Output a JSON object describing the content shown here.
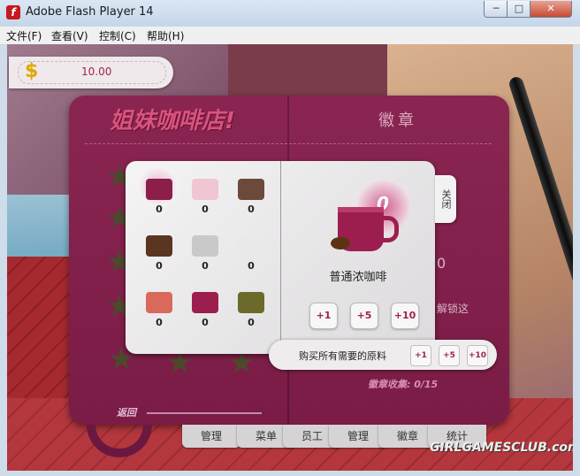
{
  "window": {
    "title": "Adobe Flash Player 14",
    "min": "─",
    "max": "□",
    "close": "✕",
    "app_icon_glyph": "f"
  },
  "menu": {
    "items": [
      "文件(F)",
      "查看(V)",
      "控制(C)",
      "帮助(H)"
    ]
  },
  "hud": {
    "currency_symbol": "$",
    "money": "10.00"
  },
  "book": {
    "title": "姐妹咖啡店!",
    "badges_title": "徽章",
    "badge_count": "徽章收集: 0/15",
    "back_label": "返回",
    "partial_zero": "0",
    "partial_unlock": "解锁这"
  },
  "panel": {
    "ingredients": [
      {
        "count": "0",
        "color": "#8c1f4a",
        "selected": true
      },
      {
        "count": "0",
        "color": "#f1c6d3"
      },
      {
        "count": "0",
        "color": "#6b4a3a"
      },
      {
        "count": "0",
        "color": "#5a3520"
      },
      {
        "count": "0",
        "color": "#c9c9c9"
      },
      {
        "count": "0",
        "color": "#e9e9e9"
      },
      {
        "count": "0",
        "color": "#d96a5b"
      },
      {
        "count": "0",
        "color": "#9c1e4f"
      },
      {
        "count": "0",
        "color": "#6b6a2a"
      }
    ],
    "selected_count": "0",
    "selected_name": "普通浓咖啡",
    "qty_buttons": [
      "+1",
      "+5",
      "+10"
    ],
    "close_tab": "关闭"
  },
  "buy_all": {
    "label": "购买所有需要的原料",
    "buttons": [
      "+1",
      "+5",
      "+10"
    ]
  },
  "bottom_tabs": [
    "管理",
    "菜单",
    "员工",
    "管理",
    "徽章",
    "统计"
  ],
  "watermark": "GIRLGAMESCLUB.com"
}
